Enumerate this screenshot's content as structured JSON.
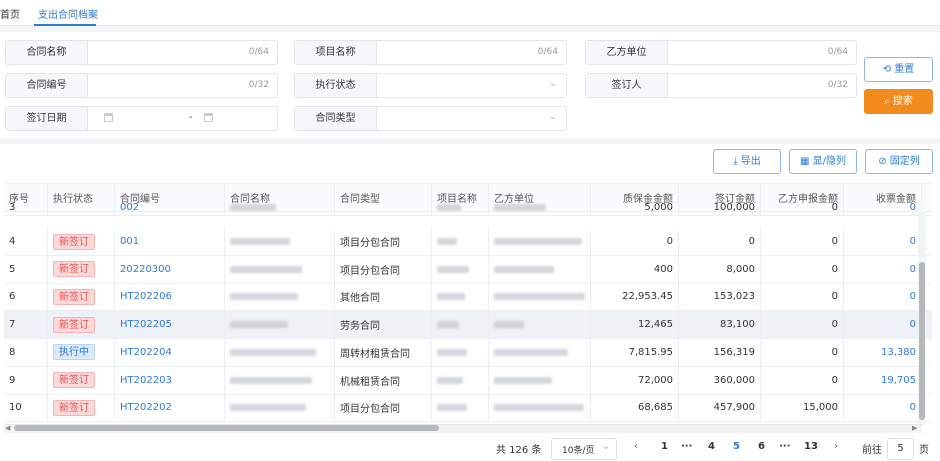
{
  "tabs": [
    {
      "label": "首页"
    },
    {
      "label": "支出合同档案"
    }
  ],
  "filters": {
    "contract_name": {
      "label": "合同名称",
      "counter": "0/64"
    },
    "project_name": {
      "label": "项目名称",
      "counter": "0/64"
    },
    "party_b": {
      "label": "乙方单位",
      "counter": "0/64"
    },
    "contract_no": {
      "label": "合同编号",
      "counter": "0/32"
    },
    "exec_status": {
      "label": "执行状态"
    },
    "signer": {
      "label": "签订人",
      "counter": "0/32"
    },
    "sign_date": {
      "label": "签订日期",
      "separator": "-"
    },
    "contract_type": {
      "label": "合同类型"
    }
  },
  "actions": {
    "reset": "重置",
    "search": "搜索"
  },
  "toolbar": {
    "export": "导出",
    "toggle_cols": "显/隐列",
    "pin_cols": "固定列"
  },
  "table": {
    "headers": [
      "序号",
      "执行状态",
      "合同编号",
      "合同名称",
      "合同类型",
      "项目名称",
      "乙方单位",
      "质保金金额",
      "签订金额",
      "乙方申报金额",
      "收票金额"
    ],
    "rows": [
      {
        "no": "3",
        "status": "",
        "code": "002",
        "type": "",
        "warranty": "5,000",
        "signed": "100,000",
        "declared": "0",
        "invoice": "0"
      },
      {
        "no": "4",
        "status": "新签订",
        "code": "001",
        "type": "项目分包合同",
        "warranty": "0",
        "signed": "0",
        "declared": "0",
        "invoice": "0"
      },
      {
        "no": "5",
        "status": "新签订",
        "code": "20220300",
        "type": "项目分包合同",
        "warranty": "400",
        "signed": "8,000",
        "declared": "0",
        "invoice": "0"
      },
      {
        "no": "6",
        "status": "新签订",
        "code": "HT202206",
        "type": "其他合同",
        "warranty": "22,953.45",
        "signed": "153,023",
        "declared": "0",
        "invoice": "0"
      },
      {
        "no": "7",
        "status": "新签订",
        "code": "HT202205",
        "type": "劳务合同",
        "warranty": "12,465",
        "signed": "83,100",
        "declared": "0",
        "invoice": "0"
      },
      {
        "no": "8",
        "status": "执行中",
        "code": "HT202204",
        "type": "周转材租赁合同",
        "warranty": "7,815.95",
        "signed": "156,319",
        "declared": "0",
        "invoice": "13,380"
      },
      {
        "no": "9",
        "status": "新签订",
        "code": "HT202203",
        "type": "机械租赁合同",
        "warranty": "72,000",
        "signed": "360,000",
        "declared": "0",
        "invoice": "19,705"
      },
      {
        "no": "10",
        "status": "新签订",
        "code": "HT202202",
        "type": "项目分包合同",
        "warranty": "68,685",
        "signed": "457,900",
        "declared": "15,000",
        "invoice": "0"
      }
    ]
  },
  "pagination": {
    "total": "共 126 条",
    "page_size": "10条/页",
    "prev": "‹",
    "pages": [
      "1",
      "···",
      "4",
      "5",
      "6",
      "···",
      "13"
    ],
    "next": "›",
    "goto_label": "前往",
    "goto_value": "5",
    "goto_suffix": "页"
  },
  "colors": {
    "accent": "#2f7bd6",
    "search_button": "#f38b1c",
    "tag_new": "#e35252"
  }
}
